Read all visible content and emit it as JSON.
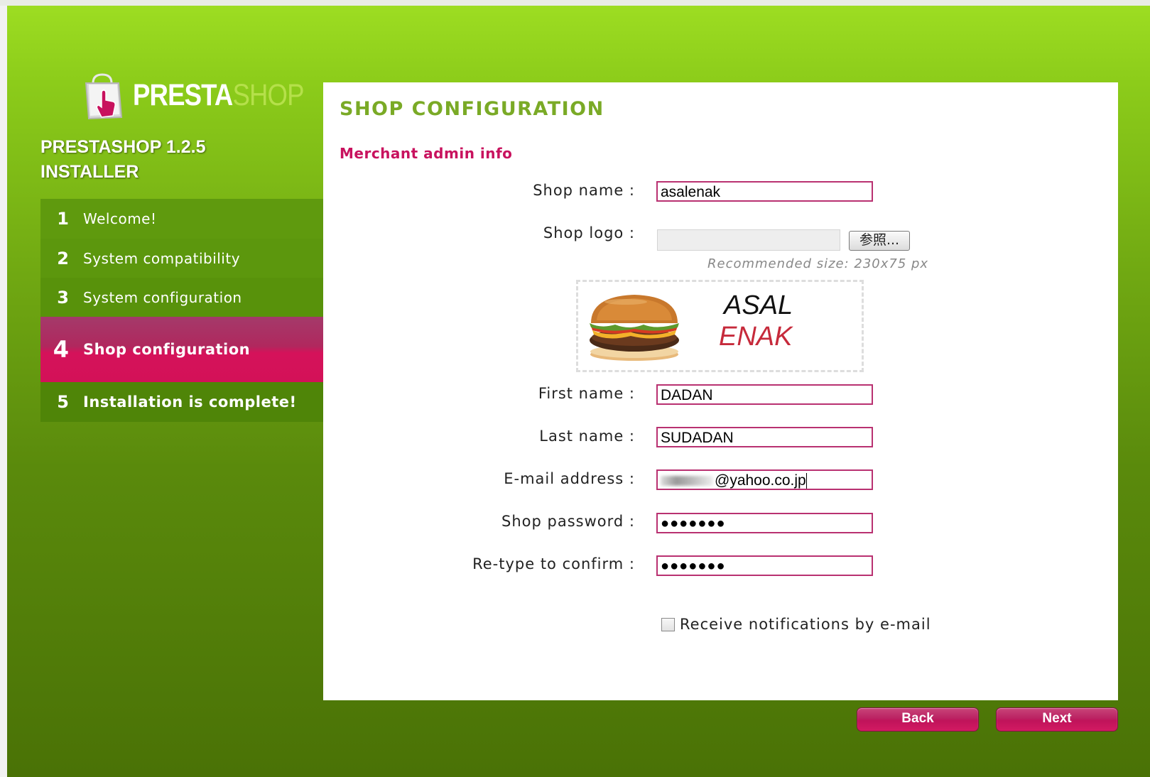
{
  "logo": {
    "presta": "PRESTA",
    "shop": "SHOP"
  },
  "installer_title": "PRESTASHOP 1.2.5 INSTALLER",
  "steps": [
    {
      "num": "1",
      "label": "Welcome!"
    },
    {
      "num": "2",
      "label": "System compatibility"
    },
    {
      "num": "3",
      "label": "System configuration"
    },
    {
      "num": "4",
      "label": "Shop configuration"
    },
    {
      "num": "5",
      "label": "Installation is complete!"
    }
  ],
  "page_title": "SHOP CONFIGURATION",
  "subsection": "Merchant admin info",
  "form": {
    "shop_name_label": "Shop name :",
    "shop_name_value": "asalenak",
    "shop_logo_label": "Shop logo :",
    "browse_label": "参照...",
    "recommended_size": "Recommended size: 230x75 px",
    "logo_preview": {
      "line1": "ASAL",
      "line2": "ENAK"
    },
    "first_name_label": "First name :",
    "first_name_value": "DADAN",
    "last_name_label": "Last name :",
    "last_name_value": "SUDADAN",
    "email_label": "E-mail address :",
    "email_value": "@yahoo.co.jp",
    "password_label": "Shop password :",
    "password_value": "●●●●●●●",
    "retype_label": "Re-type to confirm :",
    "retype_value": "●●●●●●●",
    "notifications_label": "Receive notifications by e-mail",
    "notifications_checked": false
  },
  "buttons": {
    "back": "Back",
    "next": "Next"
  },
  "colors": {
    "accent_magenta": "#c8125e",
    "title_green": "#7aaa26",
    "background_green": "#8ccc1a"
  }
}
